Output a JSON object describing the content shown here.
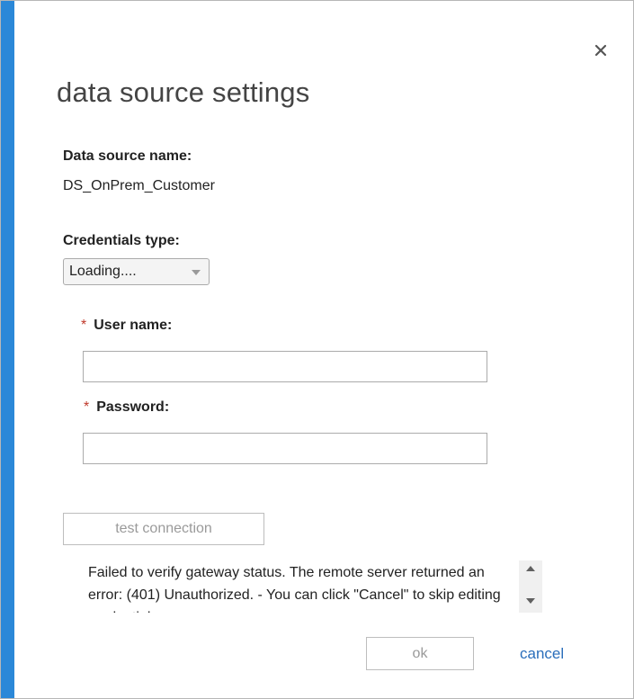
{
  "colors": {
    "accent": "#2b88d8",
    "link": "#2a6ebb",
    "required": "#c0392b"
  },
  "dialog": {
    "title": "data source settings",
    "close_icon": "close-icon"
  },
  "data_source": {
    "label": "Data source name:",
    "value": "DS_OnPrem_Customer"
  },
  "credentials": {
    "label": "Credentials type:",
    "selected": "Loading...."
  },
  "username": {
    "required_mark": "*",
    "label": "User name:",
    "value": ""
  },
  "password": {
    "required_mark": "*",
    "label": "Password:",
    "value": ""
  },
  "test_connection": {
    "label": "test connection"
  },
  "error": {
    "message": "Failed to verify gateway status. The remote server returned an error: (401) Unauthorized. - You can click \"Cancel\" to skip editing credentials."
  },
  "footer": {
    "ok_label": "ok",
    "cancel_label": "cancel"
  }
}
